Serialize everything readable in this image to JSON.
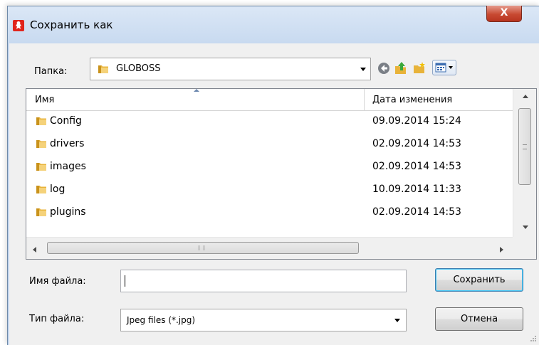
{
  "window": {
    "title": "Сохранить как",
    "close_label": "X"
  },
  "lookin": {
    "label": "Папка:",
    "value": "GLOBOSS"
  },
  "toolbar": {
    "icons": [
      "back-icon",
      "up-folder-icon",
      "new-folder-icon",
      "views-menu-icon"
    ]
  },
  "filelist": {
    "columns": {
      "name": "Имя",
      "date": "Дата изменения"
    },
    "sort_column": "Имя",
    "rows": [
      {
        "name": "Config",
        "date": "09.09.2014 15:24"
      },
      {
        "name": "drivers",
        "date": "02.09.2014 14:53"
      },
      {
        "name": "images",
        "date": "02.09.2014 14:53"
      },
      {
        "name": "log",
        "date": "10.09.2014 11:33"
      },
      {
        "name": "plugins",
        "date": "02.09.2014 14:53"
      }
    ],
    "hscroll_grip": "III"
  },
  "filename": {
    "label": "Имя файла:",
    "value": ""
  },
  "filetype": {
    "label": "Тип файла:",
    "value": "Jpeg files (*.jpg)"
  },
  "buttons": {
    "save": "Сохранить",
    "cancel": "Отмена"
  },
  "colors": {
    "window_frame": "#c5d7ef",
    "close_button": "#c84a32",
    "folder": "#e8b339",
    "default_button_glow": "#48c7f5"
  }
}
